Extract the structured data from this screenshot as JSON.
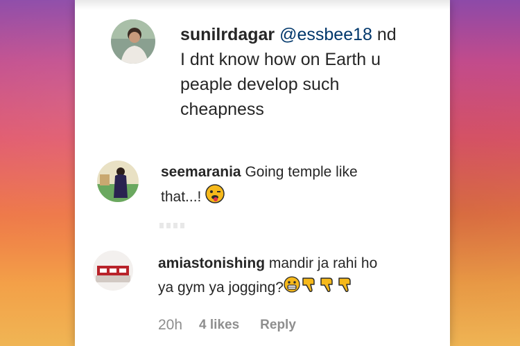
{
  "comments": [
    {
      "username": "sunilrdagar",
      "mention": "@essbee18",
      "lines": [
        "nd",
        "I dnt know how on Earth u",
        "peaple develop such",
        "cheapness"
      ]
    },
    {
      "username": "seemarania",
      "lines": [
        "Going temple like",
        "that...!"
      ],
      "emoji": "winking-tongue-face-emoji"
    },
    {
      "username": "amiastonishing",
      "lines": [
        "mandir ja rahi ho",
        "ya gym ya jogging?"
      ],
      "emojis": [
        "grinning-face-emoji",
        "thumbs-down-emoji",
        "thumbs-down-emoji",
        "thumbs-down-emoji"
      ],
      "time": "20h",
      "likes": "4 likes",
      "reply": "Reply"
    }
  ],
  "colors": {
    "username": "#262626",
    "mention": "#00376b",
    "meta": "#8e8e8e",
    "emoji_yellow": "#f6b91b",
    "emoji_dark": "#7a4a00"
  }
}
